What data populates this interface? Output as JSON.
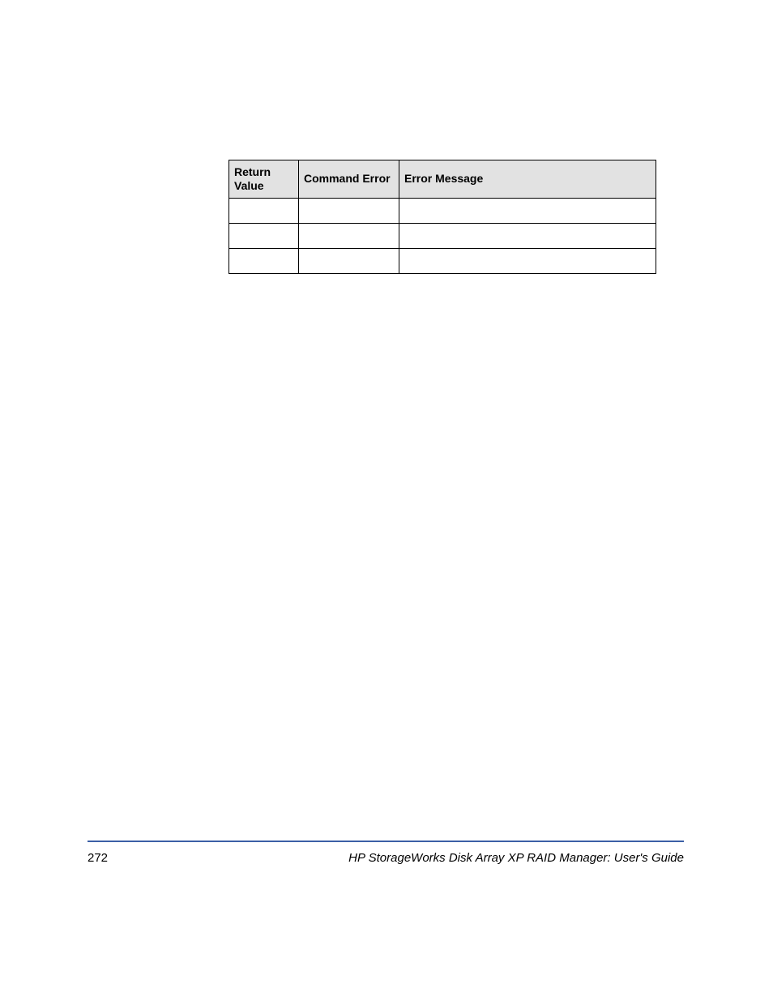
{
  "table": {
    "headers": {
      "return_value": "Return Value",
      "command_error": "Command Error",
      "error_message": "Error Message"
    },
    "rows": [
      {
        "return_value": "",
        "command_error": "",
        "error_message": ""
      },
      {
        "return_value": "",
        "command_error": "",
        "error_message": ""
      },
      {
        "return_value": "",
        "command_error": "",
        "error_message": ""
      }
    ]
  },
  "footer": {
    "page_number": "272",
    "doc_title": "HP StorageWorks Disk Array XP RAID Manager: User's Guide"
  }
}
